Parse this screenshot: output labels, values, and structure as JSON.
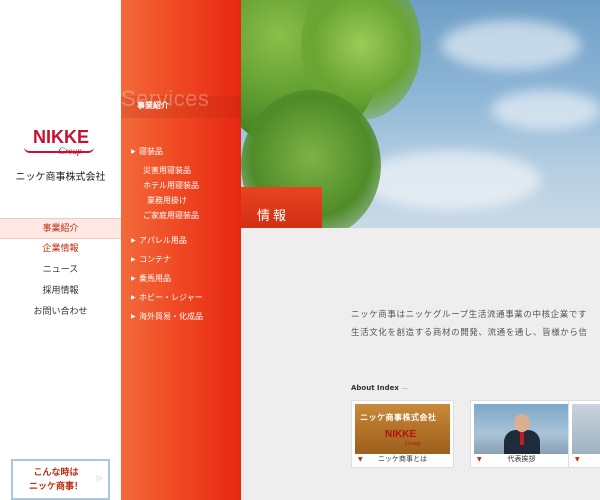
{
  "logo": {
    "brand": "NIKKE",
    "group": "Group"
  },
  "company_name": "ニッケ商事株式会社",
  "left_nav": [
    {
      "label": "事業紹介",
      "state": "active"
    },
    {
      "label": "企業情報",
      "state": "normal"
    },
    {
      "label": "ニュース",
      "state": "normal"
    },
    {
      "label": "採用情報",
      "state": "normal"
    },
    {
      "label": "お問い合わせ",
      "state": "normal"
    }
  ],
  "banner": {
    "line1": "こんな時は",
    "line2": "ニッケ商事！",
    "arrow": "▷"
  },
  "services": {
    "watermark": "Services",
    "heading": "事業紹介",
    "menu": [
      {
        "label": "寝装品"
      },
      {
        "label": "災害用寝装品",
        "sub": true
      },
      {
        "label": "ホテル用寝装品",
        "sub": true
      },
      {
        "label": "業務用掛け",
        "sub": true
      },
      {
        "label": "ご家庭用寝装品",
        "sub": true
      },
      {
        "label": "アパレル用品"
      },
      {
        "label": "コンテナ"
      },
      {
        "label": "乗馬用品"
      },
      {
        "label": "ホビー・レジャー"
      },
      {
        "label": "海外貿易・化成品"
      }
    ]
  },
  "hero_title": "情報",
  "intro": {
    "line1": "ニッケ商事はニッケグループ生活流通事業の中核企業です",
    "line2": "生活文化を創造する商材の開発、流通を通し、皆様から信"
  },
  "about_index": {
    "label": "About Index",
    "dash": "—"
  },
  "cards": [
    {
      "caption": "ニッケ商事とは",
      "wood_text": "ニッケ商事株式会社",
      "wood_logo": "NIKKE",
      "wood_group": "Group"
    },
    {
      "caption": "代表挨拶"
    },
    {
      "caption": ""
    }
  ],
  "colors": {
    "accent": "#c02a10",
    "orange_panel": "#f04a24",
    "brand_red": "#c8102e",
    "banner_border": "#a9c8de"
  }
}
